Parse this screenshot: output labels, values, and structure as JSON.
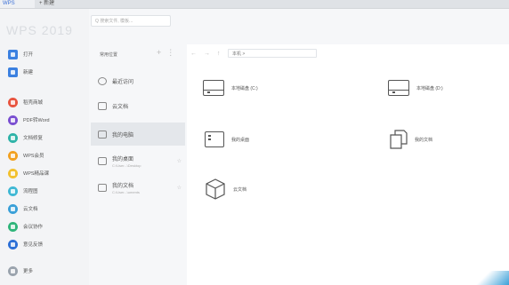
{
  "tabs": {
    "home": "WPS",
    "new": "+ 新建"
  },
  "brand": "WPS 2019",
  "search": {
    "placeholder": "Q 搜索文件, 模板..."
  },
  "sidebar": {
    "items": [
      {
        "label": "打开",
        "icon": "folder-icon",
        "color": "#3b80e0"
      },
      {
        "label": "新建",
        "icon": "new-file-icon",
        "color": "#3b80e0"
      },
      {
        "label": "稻壳商城",
        "icon": "docer-icon",
        "color": "#e8543f"
      },
      {
        "label": "PDF转Word",
        "icon": "pdf-icon",
        "color": "#7a4fd1"
      },
      {
        "label": "文档修复",
        "icon": "repair-icon",
        "color": "#2fb3a8"
      },
      {
        "label": "WPS会员",
        "icon": "member-icon",
        "color": "#f2a120"
      },
      {
        "label": "WPS精品课",
        "icon": "course-icon",
        "color": "#f2c12e"
      },
      {
        "label": "流程图",
        "icon": "flowchart-icon",
        "color": "#3fb8d4"
      },
      {
        "label": "云文档",
        "icon": "cloud-icon",
        "color": "#3aa0d8"
      },
      {
        "label": "会议协作",
        "icon": "meeting-icon",
        "color": "#2fb57a"
      },
      {
        "label": "意见反馈",
        "icon": "feedback-icon",
        "color": "#2c6fd6"
      },
      {
        "label": "更多",
        "icon": "more-icon",
        "color": "#9aa3ad"
      }
    ]
  },
  "locations": {
    "header": "常用位置",
    "items": [
      {
        "label": "最近访问",
        "sub": ""
      },
      {
        "label": "云文档",
        "sub": ""
      },
      {
        "label": "我的电脑",
        "sub": ""
      },
      {
        "label": "我的桌面",
        "sub": "C:\\User...\\Desktop"
      },
      {
        "label": "我的文档",
        "sub": "C:\\User...\\uments"
      }
    ]
  },
  "content": {
    "nav": "← → ↑",
    "path": "本机 >",
    "items": [
      {
        "label": "本地磁盘 (C:)",
        "icon": "drive-icon"
      },
      {
        "label": "本地磁盘 (D:)",
        "icon": "drive-icon"
      },
      {
        "label": "我的桌面",
        "icon": "desktop-icon"
      },
      {
        "label": "我的文档",
        "icon": "documents-icon"
      },
      {
        "label": "云文档",
        "icon": "cloud-doc-icon"
      }
    ]
  }
}
